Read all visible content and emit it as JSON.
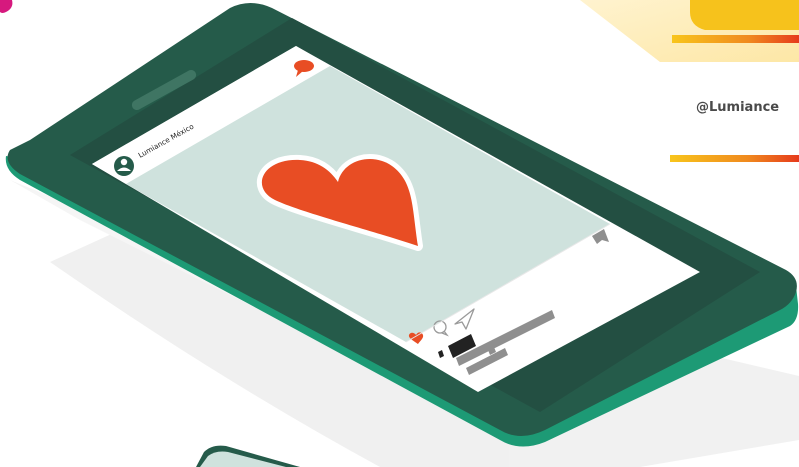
{
  "post": {
    "account_name": "Lumiance México",
    "liked": true
  },
  "social": {
    "handle": "@Lumiance"
  },
  "colors": {
    "phone_dark": "#255b4a",
    "phone_edge": "#1d9a75",
    "screen_bg": "#cfe2dd",
    "heart": "#e84d24",
    "brand_yellow": "#f6c21c",
    "brand_red": "#e8381c",
    "accent_magenta": "#d6197e"
  },
  "icons": {
    "avatar": "user-avatar-icon",
    "messages": "speech-bubble-icon",
    "like": "heart-icon",
    "comment": "comment-icon",
    "share": "send-icon",
    "save": "bookmark-icon"
  }
}
